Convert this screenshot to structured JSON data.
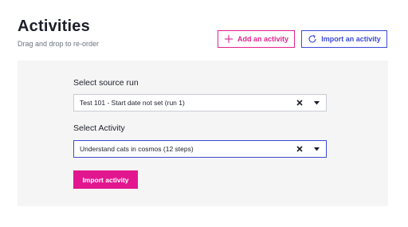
{
  "header": {
    "title": "Activities",
    "subtitle": "Drag and drop to re-order"
  },
  "toolbar": {
    "add_label": "Add an activity",
    "import_label": "Import an activity",
    "add_icon": "plus-icon",
    "import_icon": "refresh-icon"
  },
  "form": {
    "source_run_label": "Select source run",
    "source_run_value": "Test 101 - Start date not set (run 1)",
    "activity_label": "Select Activity",
    "activity_value": "Understand cats in cosmos (12 steps)",
    "import_button_label": "Import activity"
  },
  "colors": {
    "accent_pink": "#e2168f",
    "accent_blue": "#3b49d6",
    "panel_bg": "#f5f5f5"
  }
}
